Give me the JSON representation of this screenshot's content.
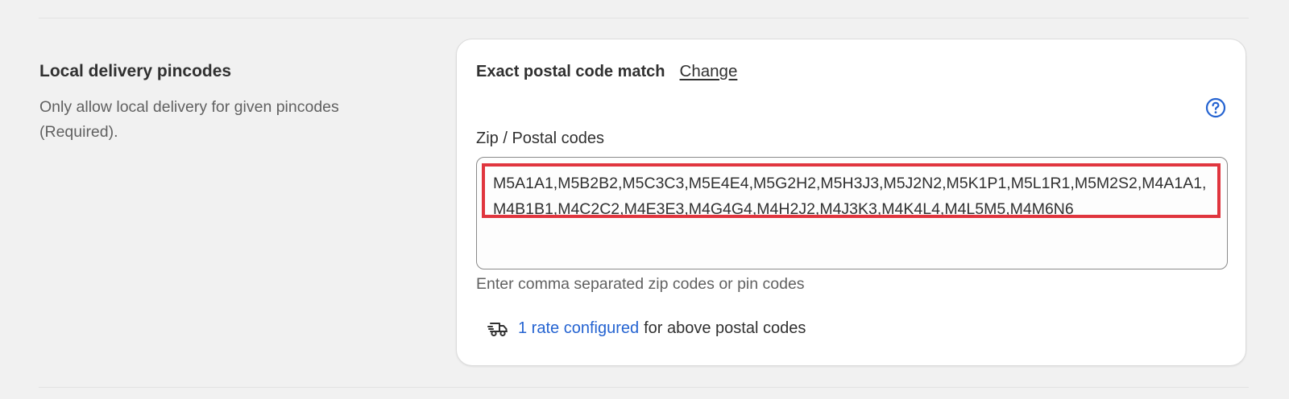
{
  "section": {
    "title": "Local delivery pincodes",
    "description": "Only allow local delivery for given pincodes (Required)."
  },
  "card": {
    "match_label": "Exact postal code match",
    "change_label": "Change",
    "help_icon": "question-circle-icon",
    "field_label": "Zip / Postal codes",
    "zip_codes_value": "M5A1A1,M5B2B2,M5C3C3,M5E4E4,M5G2H2,M5H3J3,M5J2N2,M5K1P1,M5L1R1,M5M2S2,M4A1A1,M4B1B1,M4C2C2,M4E3E3,M4G4G4,M4H2J2,M4J3K3,M4K4L4,M4L5M5,M4M6N6",
    "help_text": "Enter comma separated zip codes or pin codes",
    "rate_icon": "delivery-truck-icon",
    "rate_link": "1 rate configured",
    "rate_suffix": "for above postal codes"
  },
  "colors": {
    "link": "#2463d1",
    "highlight_border": "#e0353e",
    "background": "#f1f1f1",
    "card": "#ffffff"
  }
}
